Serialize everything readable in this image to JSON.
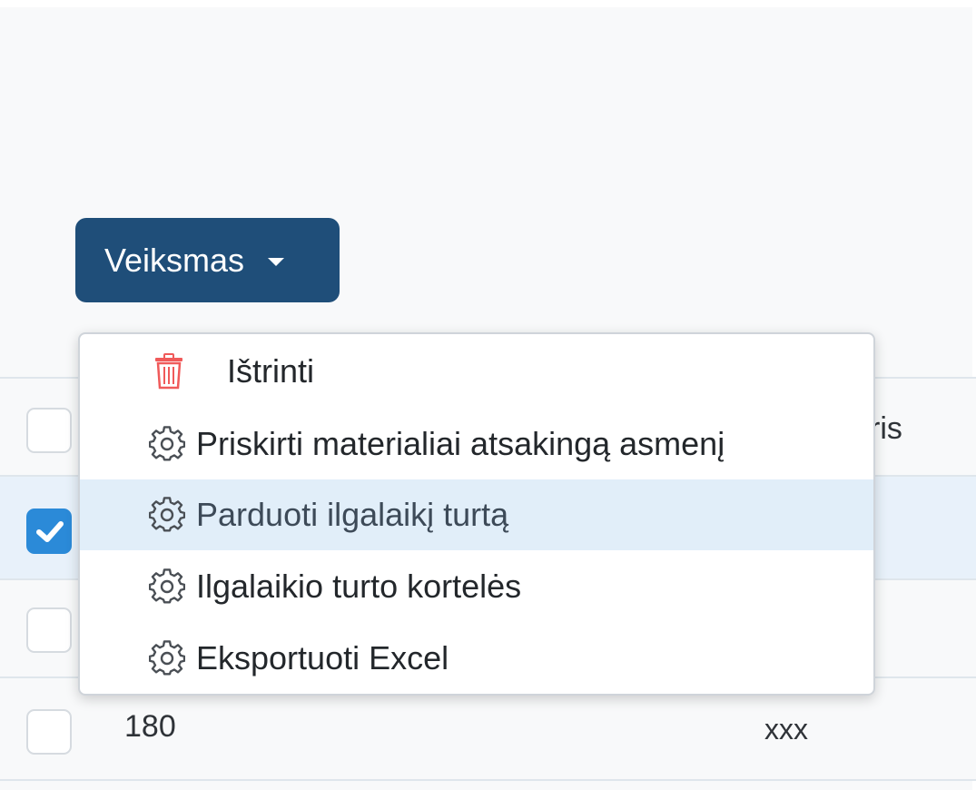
{
  "toolbar": {
    "action_label": "Veiksmas"
  },
  "menu": {
    "items": [
      {
        "label": "Ištrinti",
        "icon": "trash-icon"
      },
      {
        "label": "Priskirti materialiai atsakingą asmenį",
        "icon": "gear-icon"
      },
      {
        "label": "Parduoti ilgalaikį turtą",
        "icon": "gear-icon"
      },
      {
        "label": "Ilgalaikio turto kortelės",
        "icon": "gear-icon"
      },
      {
        "label": "Eksportuoti Excel",
        "icon": "gear-icon"
      }
    ]
  },
  "table": {
    "header_partial_label": "ris",
    "rows": [
      {
        "checked": true
      },
      {
        "checked": false
      },
      {
        "checked": false,
        "number": "180",
        "code": "xxx"
      }
    ]
  },
  "colors": {
    "primary_button": "#1f4e79",
    "checkbox_checked": "#2b8ad8",
    "menu_hover": "#e1eef9",
    "delete_icon": "#f05a5a",
    "selected_row": "#e8f1fa"
  }
}
